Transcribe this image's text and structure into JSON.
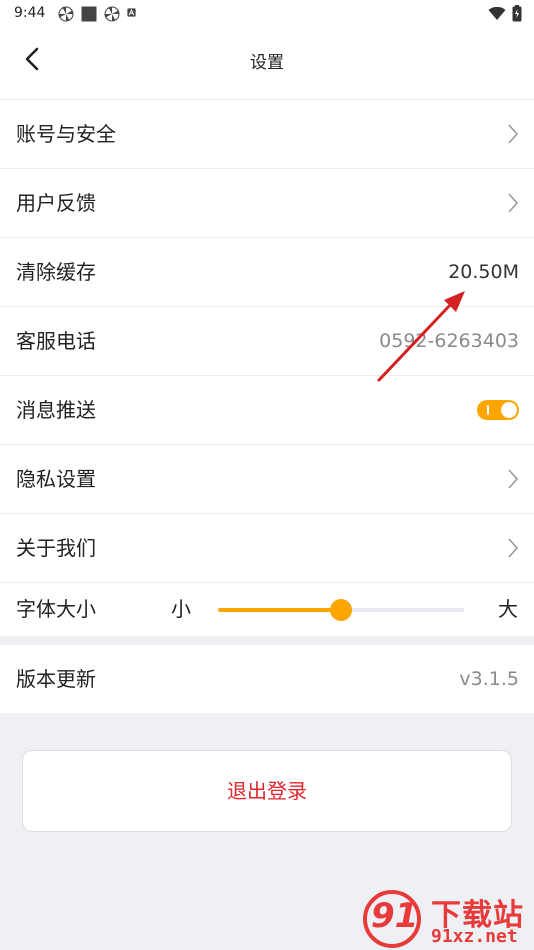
{
  "status_bar": {
    "time": "9:44",
    "left_icons": [
      "pinwheel-icon",
      "square-icon",
      "pinwheel-icon",
      "a-badge-icon"
    ],
    "right_icons": [
      "wifi-icon",
      "battery-icon"
    ]
  },
  "nav": {
    "title": "设置",
    "back_icon": "chevron-left-icon"
  },
  "settings": {
    "account": {
      "label": "账号与安全"
    },
    "feedback": {
      "label": "用户反馈"
    },
    "cache": {
      "label": "清除缓存",
      "value": "20.50M"
    },
    "phone": {
      "label": "客服电话",
      "value": "0592-6263403"
    },
    "push": {
      "label": "消息推送",
      "enabled": true
    },
    "privacy": {
      "label": "隐私设置"
    },
    "about": {
      "label": "关于我们"
    },
    "font_size": {
      "label": "字体大小",
      "min_label": "小",
      "max_label": "大",
      "level": 0.5
    }
  },
  "version": {
    "label": "版本更新",
    "value": "v3.1.5"
  },
  "logout": {
    "label": "退出登录"
  },
  "watermark": {
    "number": "91",
    "title": "下载站",
    "url": "91xz.net"
  },
  "colors": {
    "accent": "#ffa500",
    "logout_text": "#e0272d",
    "secondary_text": "#8a8a8a",
    "value_text": "#333333",
    "annotation_arrow": "#d42020",
    "background": "#eef0f4"
  }
}
